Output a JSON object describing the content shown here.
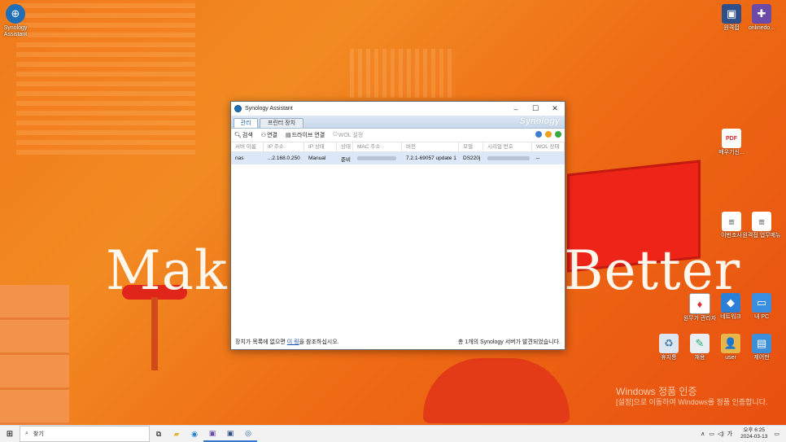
{
  "desktop": {
    "wallpaper_text_left": "Make",
    "wallpaper_text_right": "Better",
    "activation_title": "Windows 정품 인증",
    "activation_sub": "[설정]으로 이동하여 Windows를 정품 인증합니다.",
    "icons": [
      {
        "label": "Synology Assistant"
      },
      {
        "label": "원격접"
      },
      {
        "label": "onlinedo..."
      },
      {
        "label": "배우기신..."
      },
      {
        "label": "이번조사"
      },
      {
        "label": "원격접 업무메뉴"
      },
      {
        "label": "원무가 관리자"
      },
      {
        "label": "네트워크"
      },
      {
        "label": "내 PC"
      },
      {
        "label": "휴지통"
      },
      {
        "label": "채용"
      },
      {
        "label": "user"
      },
      {
        "label": "제어판"
      }
    ]
  },
  "window": {
    "title": "Synology Assistant",
    "controls": {
      "minimize": "–",
      "maximize": "☐",
      "close": "✕"
    },
    "tabs": [
      {
        "label": "관리"
      },
      {
        "label": "프린터 장치"
      }
    ],
    "brand": "Synology",
    "toolbar": {
      "search": "검색",
      "connect": "연결",
      "map_drive": "드라이브 연결",
      "wol": "WOL 설정"
    },
    "columns": [
      "서버 이름",
      "IP 주소",
      "IP 상태",
      "상태",
      "MAC 주소",
      "버전",
      "모델",
      "시리얼 번호",
      "WOL 상태"
    ],
    "rows": [
      {
        "name": "nas",
        "ip": "...2.168.0.250",
        "ip_status": "Manual",
        "status": "준비",
        "mac": "",
        "version": "7.2.1-69057 update 1",
        "model": "DS220j",
        "serial": "",
        "wol": "--"
      }
    ],
    "status_left_prefix": "장치가 목록에 없으면 ",
    "status_link": "이 링",
    "status_left_suffix": "을 참조하십시오.",
    "status_right": "총 1개의 Synology 서버가 발견되었습니다."
  },
  "taskbar": {
    "search_placeholder": "찾기",
    "time": "오후 6:25",
    "date": "2024-03-13"
  },
  "colors": {
    "accent": "#1c5fa8",
    "wallpaper": "#f07a1a",
    "selected_row": "#dce8f7"
  }
}
